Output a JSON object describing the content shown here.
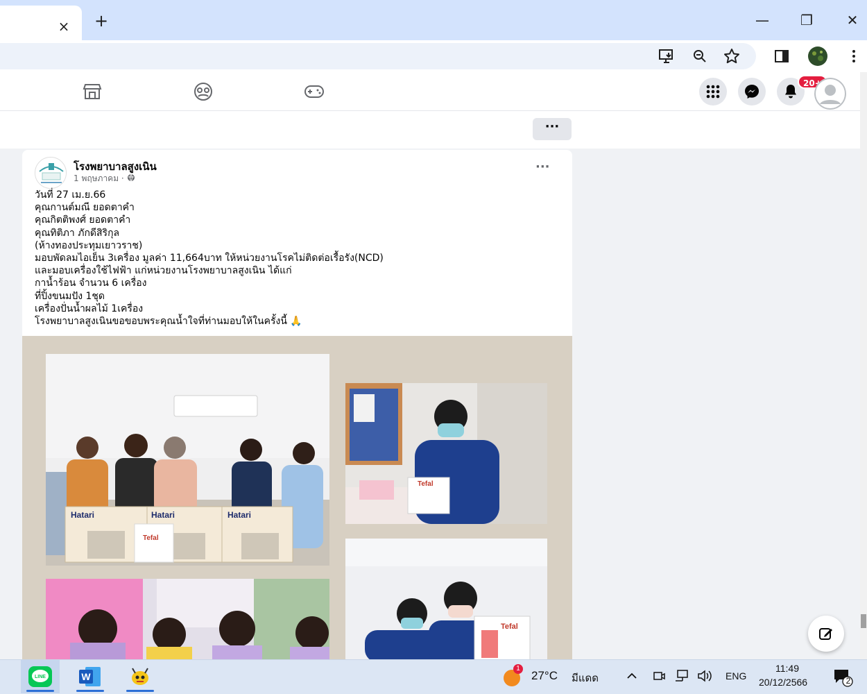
{
  "browser": {
    "close_tab_glyph": "×",
    "new_tab_glyph": "+",
    "minimize_glyph": "—",
    "maximize_glyph": "❐",
    "close_glyph": "✕"
  },
  "fbnav": {
    "notification_badge": "20+"
  },
  "subbar": {
    "more_label": "···"
  },
  "post": {
    "page_name": "โรงพยาบาลสูงเนิน",
    "date": "1 พฤษภาคม · ",
    "menu_label": "···",
    "lines": [
      "วันที่ 27 เม.ย.66",
      "คุณกานต์มณี  ยอดตาคำ",
      "คุณกิตติพงศ์  ยอดตาคำ",
      "คุณทิติภา ภักดีสิริกุล",
      "(ห้างทองประทุมเยาวราช)",
      "มอบพัดลมไอเย็น 3เครื่อง มูลค่า 11,664บาท ให้หน่วยงานโรคไม่ติดต่อเรื้อรัง(NCD)",
      "และมอบเครื่องใช้ไฟฟ้า แก่หน่วยงานโรงพยาบาลสูงเนิน ได้แก่",
      "กาน้ำร้อน จำนวน 6 เครื่อง",
      "ที่ปิ้งขนมปัง 1ชุด",
      "เครื่องปั่นน้ำผลไม้ 1เครื่อง",
      "โรงพยาบาลสูงเนินขอขอบพระคุณน้ำใจที่ท่านมอบให้ในครั้งนี้ 🙏"
    ],
    "photo_labels": {
      "box1": "Hatari",
      "box2": "Hatari",
      "box3": "Hatari",
      "kettle": "Tefal",
      "kettle2": "Tefal",
      "kettle3": "Tefal"
    }
  },
  "taskbar": {
    "weather_temp": "27°C",
    "weather_desc": "มีแดด",
    "weather_badge": "1",
    "language": "ENG",
    "time": "11:49",
    "date": "20/12/2566",
    "notification_count": "2",
    "line_label": "LINE",
    "word_label": "W"
  },
  "colors": {
    "fb_blue": "#1877f2",
    "badge_red": "#e41e3f",
    "chrome_tab": "#d3e3fd",
    "taskbar": "#dce6f4"
  }
}
